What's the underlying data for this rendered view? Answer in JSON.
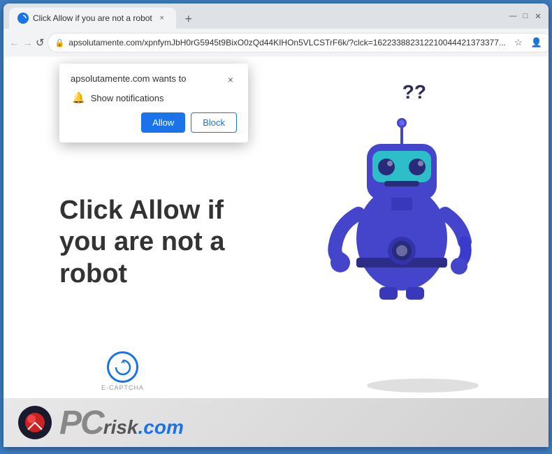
{
  "browser": {
    "tab_title": "Click Allow if you are not a robot",
    "tab_favicon": "C",
    "address": "apsolutamente.com/xpnfymJbH0rG5945t9BixO0zQd44KIHOn5VLCSTrF6k/?clck=162233882312210044421373377...",
    "new_tab_label": "+",
    "window_controls": {
      "minimize": "—",
      "maximize": "□",
      "close": "✕"
    }
  },
  "nav": {
    "back": "←",
    "forward": "→",
    "reload": "↺"
  },
  "popup": {
    "title": "apsolutamente.com wants to",
    "notification_label": "Show notifications",
    "allow_button": "Allow",
    "block_button": "Block",
    "close": "×"
  },
  "main_page": {
    "heading_line1": "Click Allow if",
    "heading_line2": "you are not a",
    "heading_line3": "robot",
    "ecaptcha_label": "E-CAPTCHA"
  },
  "pcrisk": {
    "text_pc": "PC",
    "text_risk": "risk",
    "text_com": ".com"
  },
  "colors": {
    "blue_primary": "#1a73e8",
    "robot_blue": "#4040cc",
    "dark_navy": "#2d2d5e"
  }
}
